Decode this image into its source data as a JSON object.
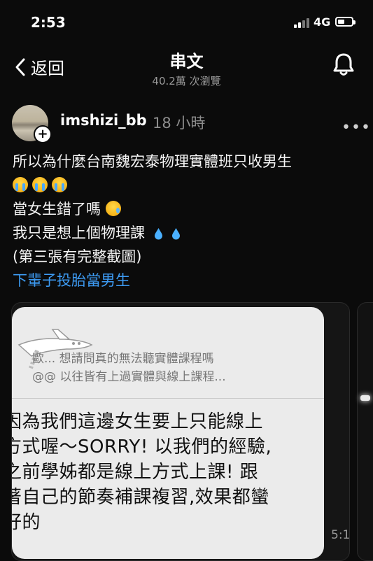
{
  "status_bar": {
    "time": "2:53",
    "network": "4G"
  },
  "header": {
    "back_label": "返回",
    "title": "串文",
    "views": "40.2萬 次瀏覽"
  },
  "post": {
    "username": "imshizi_bb",
    "time_ago": "18 小時",
    "lines": [
      "所以為什麼台南魏宏泰物理實體班只收男生",
      "當女生錯了嗎",
      "我只是想上個物理課",
      "(第三張有完整截圖)"
    ],
    "hashtag": "下輩子投胎當男生"
  },
  "image": {
    "quoted_line_1": "歐... 想請問真的無法聽實體課程嗎",
    "quoted_line_2": "@@ 以往皆有上過實體與線上課程...",
    "reply_lines": [
      "因為我們這邊女生要上只能線上",
      "方式喔～SORRY!  以我們的經驗,",
      "之前學姊都是線上方式上課! 跟",
      "著自己的節奏補課複習,效果都蠻",
      "好的"
    ],
    "timestamp": "5:1"
  },
  "icons": {
    "back": "chevron-left-icon",
    "bell": "bell-icon",
    "more": "more-horizontal-icon"
  },
  "colors": {
    "background": "#0b0b0b",
    "hashtag": "#3d9bf3",
    "bubble": "#ebebeb"
  }
}
